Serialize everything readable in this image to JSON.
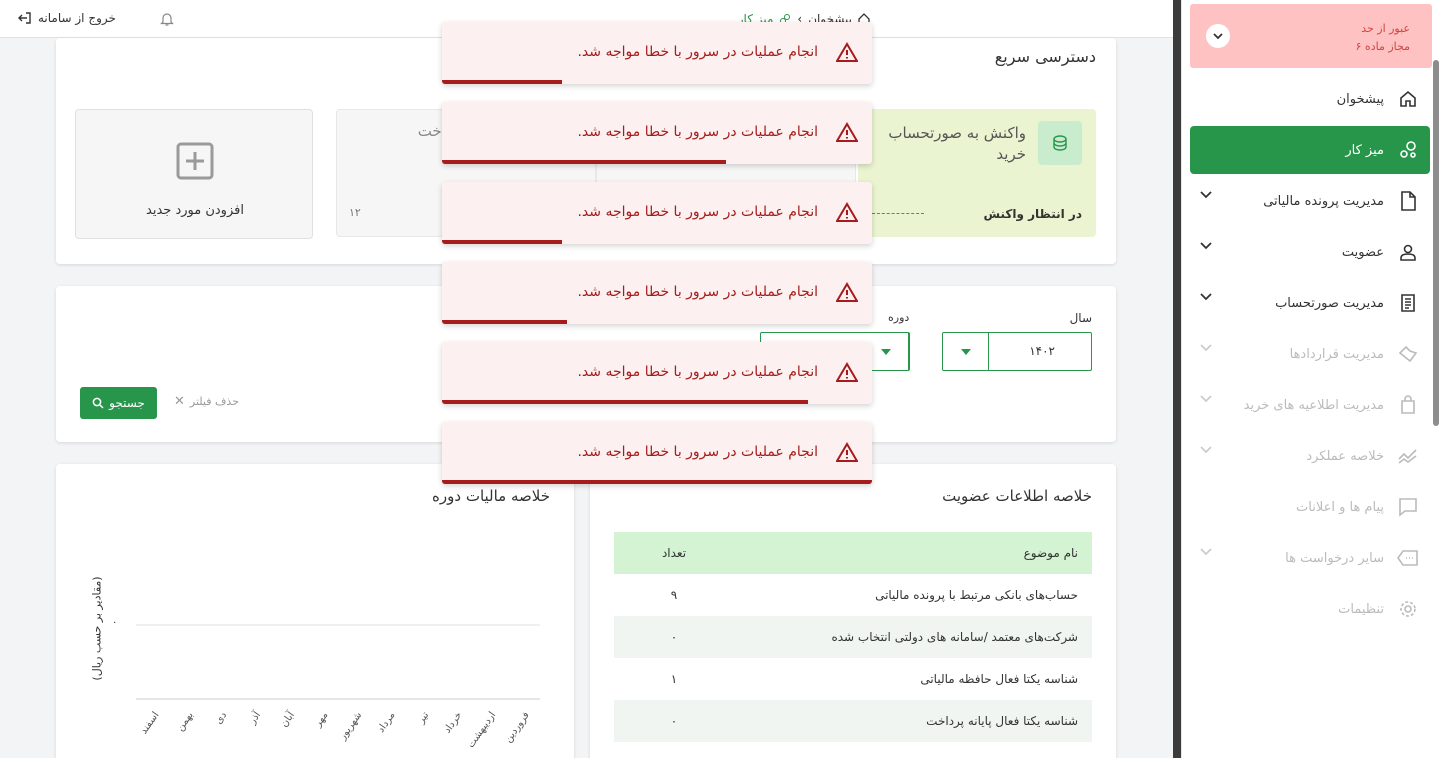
{
  "header": {
    "logout_label": "خروج از سامانه",
    "breadcrumb_home": "پیشخوان",
    "breadcrumb_current": "میز کار"
  },
  "sidebar": {
    "alert_line1": "عبور از حد",
    "alert_line2": "مجاز ماده ۶",
    "items": [
      {
        "label": "پیشخوان",
        "icon": "home-icon"
      },
      {
        "label": "میز کار",
        "icon": "workdesk-icon"
      },
      {
        "label": "مدیریت پرونده مالیاتی",
        "icon": "file-icon"
      },
      {
        "label": "عضویت",
        "icon": "user-icon"
      },
      {
        "label": "مدیریت صورتحساب",
        "icon": "invoice-icon"
      },
      {
        "label": "مدیریت قراردادها",
        "icon": "handshake-icon"
      },
      {
        "label": "مدیریت اطلاعیه های خرید",
        "icon": "bag-icon"
      },
      {
        "label": "خلاصه عملکرد",
        "icon": "chart-line-icon"
      },
      {
        "label": "پیام ها و اعلانات",
        "icon": "message-icon"
      },
      {
        "label": "سایر درخواست ها",
        "icon": "ticket-icon"
      },
      {
        "label": "تنظیمات",
        "icon": "gear-icon"
      }
    ]
  },
  "quick_access": {
    "title": "دسترسی سریع",
    "card1_title": "واکنش به صورتحساب خرید",
    "card1_status": "در انتظار واکنش",
    "card2_title": "پرداخت",
    "card2_count": "۱۲",
    "add_label": "افزودن مورد جدید"
  },
  "filter": {
    "year_label": "سال",
    "year_value": "۱۴۰۲",
    "period_label": "دوره",
    "clear_label": "حذف فیلتر",
    "search_label": "جستجو"
  },
  "membership": {
    "title": "خلاصه اطلاعات عضویت",
    "col_subject": "نام موضوع",
    "col_count": "تعداد",
    "rows": [
      {
        "subject": "حساب‌های بانکی مرتبط با پرونده مالیاتی",
        "count": "۹"
      },
      {
        "subject": "شرکت‌های معتمد /سامانه های دولتی انتخاب شده",
        "count": "۰"
      },
      {
        "subject": "شناسه یکتا فعال حافظه مالیاتی",
        "count": "۱"
      },
      {
        "subject": "شناسه یکتا فعال پایانه پرداخت",
        "count": "۰"
      }
    ]
  },
  "chart_data": {
    "type": "bar",
    "title": "خلاصه مالیات دوره",
    "ylabel": "(مقادیر بر حسب ریال)",
    "y_tick": "۰",
    "categories": [
      "فروردین",
      "اردیبهشت",
      "خرداد",
      "تیر",
      "مرداد",
      "شهریور",
      "مهر",
      "آبان",
      "آذر",
      "دی",
      "بهمن",
      "اسفند"
    ],
    "values": [
      0,
      0,
      0,
      0,
      0,
      0,
      0,
      0,
      0,
      0,
      0,
      0
    ]
  },
  "toasts": [
    {
      "message": "انجام عملیات در سرور با خطا مواجه شد.",
      "progress": 0.28
    },
    {
      "message": "انجام عملیات در سرور با خطا مواجه شد.",
      "progress": 0.66
    },
    {
      "message": "انجام عملیات در سرور با خطا مواجه شد.",
      "progress": 0.28
    },
    {
      "message": "انجام عملیات در سرور با خطا مواجه شد.",
      "progress": 0.29
    },
    {
      "message": "انجام عملیات در سرور با خطا مواجه شد.",
      "progress": 0.85
    },
    {
      "message": "انجام عملیات در سرور با خطا مواجه شد.",
      "progress": 1.0
    }
  ],
  "colors": {
    "primary": "#27954a",
    "error": "#a61c1c",
    "toast_bg": "#fdf0f0",
    "alert_bg": "#ffc2c2"
  }
}
